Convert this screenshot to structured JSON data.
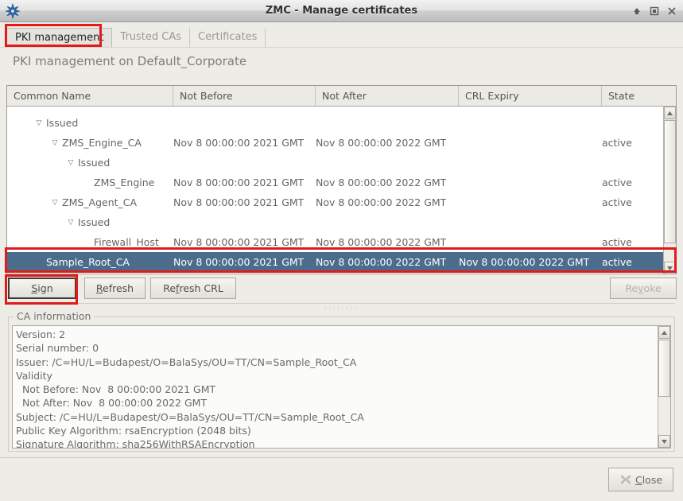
{
  "window": {
    "title": "ZMC - Manage certificates",
    "icon": "app-star-icon",
    "controls": [
      {
        "name": "shade-button",
        "glyph": "↑"
      },
      {
        "name": "maximize-button",
        "glyph": "□"
      },
      {
        "name": "close-button",
        "glyph": "✕"
      }
    ]
  },
  "tabs": [
    {
      "label": "PKI management",
      "active": true
    },
    {
      "label": "Trusted CAs",
      "active": false
    },
    {
      "label": "Certificates",
      "active": false
    }
  ],
  "page": {
    "heading": "PKI management on Default_Corporate"
  },
  "table": {
    "columns": [
      "Common Name",
      "Not Before",
      "Not After",
      "CRL Expiry",
      "State"
    ],
    "rows": [
      {
        "clipped": true,
        "indent": 2,
        "twisty": "",
        "name": "",
        "not_before": "",
        "not_after": "",
        "crl_expiry": "",
        "state": "",
        "selected": false
      },
      {
        "indent": 1,
        "twisty": "▽",
        "name": "Issued",
        "not_before": "",
        "not_after": "",
        "crl_expiry": "",
        "state": "",
        "selected": false
      },
      {
        "indent": 2,
        "twisty": "▽",
        "name": "ZMS_Engine_CA",
        "not_before": "Nov  8 00:00:00 2021 GMT",
        "not_after": "Nov  8 00:00:00 2022 GMT",
        "crl_expiry": "",
        "state": "active",
        "selected": false
      },
      {
        "indent": 3,
        "twisty": "▽",
        "name": "Issued",
        "not_before": "",
        "not_after": "",
        "crl_expiry": "",
        "state": "",
        "selected": false
      },
      {
        "indent": 4,
        "twisty": "",
        "name": "ZMS_Engine",
        "not_before": "Nov  8 00:00:00 2021 GMT",
        "not_after": "Nov  8 00:00:00 2022 GMT",
        "crl_expiry": "",
        "state": "active",
        "selected": false
      },
      {
        "indent": 2,
        "twisty": "▽",
        "name": "ZMS_Agent_CA",
        "not_before": "Nov  8 00:00:00 2021 GMT",
        "not_after": "Nov  8 00:00:00 2022 GMT",
        "crl_expiry": "",
        "state": "active",
        "selected": false
      },
      {
        "indent": 3,
        "twisty": "▽",
        "name": "Issued",
        "not_before": "",
        "not_after": "",
        "crl_expiry": "",
        "state": "",
        "selected": false
      },
      {
        "indent": 4,
        "twisty": "",
        "name": "Firewall_Host",
        "not_before": "Nov  8 00:00:00 2021 GMT",
        "not_after": "Nov  8 00:00:00 2022 GMT",
        "crl_expiry": "",
        "state": "active",
        "selected": false
      },
      {
        "indent": 1,
        "twisty": "",
        "name": "Sample_Root_CA",
        "not_before": "Nov  8 00:00:00 2021 GMT",
        "not_after": "Nov  8 00:00:00 2022 GMT",
        "crl_expiry": "Nov  8 00:00:00 2022 GMT",
        "state": "active",
        "selected": true
      }
    ]
  },
  "actions": {
    "sign": {
      "label": "Sign",
      "mnemonic": "S",
      "enabled": true,
      "highlighted": true
    },
    "refresh": {
      "label": "Refresh",
      "mnemonic": "R",
      "enabled": true
    },
    "refresh_crl": {
      "label": "Refresh CRL",
      "mnemonic": "f",
      "enabled": true
    },
    "revoke": {
      "label": "Revoke",
      "mnemonic": "v",
      "enabled": false
    }
  },
  "ca_information": {
    "legend": "CA information",
    "text": "Version: 2\nSerial number: 0\nIssuer: /C=HU/L=Budapest/O=BalaSys/OU=TT/CN=Sample_Root_CA\nValidity\n  Not Before: Nov  8 00:00:00 2021 GMT\n  Not After: Nov  8 00:00:00 2022 GMT\nSubject: /C=HU/L=Budapest/O=BalaSys/OU=TT/CN=Sample_Root_CA\nPublic Key Algorithm: rsaEncryption (2048 bits)\nSignature Algorithm: sha256WithRSAEncryption"
  },
  "footer": {
    "close": {
      "label": "Close",
      "mnemonic": "C",
      "icon": "close-x-icon"
    }
  },
  "colors": {
    "selection": "#4c6c8c",
    "annotation": "#e01b1b",
    "window_bg": "#edece7",
    "tree_bg": "#ffffff",
    "text": "#656565"
  }
}
